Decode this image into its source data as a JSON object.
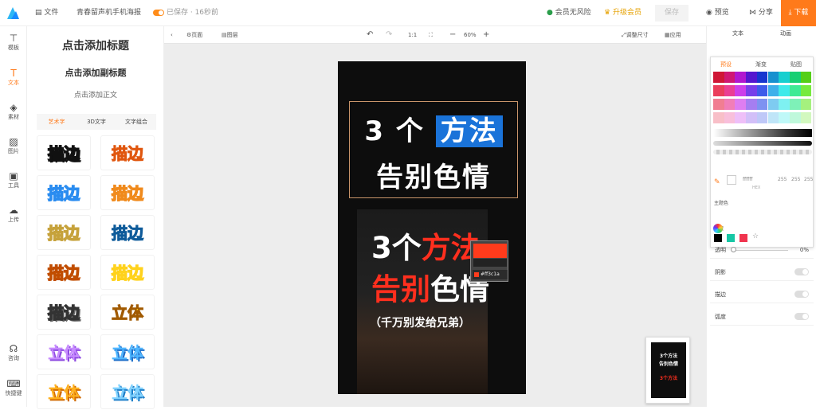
{
  "topbar": {
    "file": "文件",
    "doc_title": "青春留声机手机海报",
    "autosave": "已保存 · 16秒前",
    "no_risk": "会员无风险",
    "upgrade": "升级会员",
    "save": "保存",
    "preview": "预览",
    "share": "分享",
    "download": "下载"
  },
  "rail": [
    "模板",
    "文本",
    "素材",
    "图片",
    "工具",
    "上传",
    "咨询",
    "快捷键"
  ],
  "text_panel": {
    "add_title": "点击添加标题",
    "add_subtitle": "点击添加副标题",
    "add_body": "点击添加正文",
    "tabs": [
      "艺术字",
      "3D文字",
      "文字组合"
    ],
    "styles": [
      "描边",
      "描边",
      "描边",
      "描边",
      "描边",
      "描边",
      "描边",
      "描边",
      "描边",
      "立体",
      "立体",
      "立体",
      "立体",
      "立体"
    ]
  },
  "workspace": {
    "page": "页面",
    "layer": "图层",
    "ratio": "1:1",
    "zoom": "60%",
    "resize": "调整尺寸",
    "apply": "应用"
  },
  "poster": {
    "title_num": "3",
    "title_ge": "个",
    "title_hl": "方法",
    "title_line2": "告别色情",
    "photo_line1_a": "3个",
    "photo_line1_b": "方法",
    "photo_line2_a": "告别",
    "photo_line2_b": "色情",
    "photo_line3": "（千万别发给兄弟）",
    "picker_hex": "#ff3c1a"
  },
  "right_panel": {
    "tabs": [
      "文本",
      "动画"
    ],
    "picker_tabs": [
      "预设",
      "渐变",
      "贴图"
    ],
    "hex_label": "HEX",
    "hex_value": "ffffff",
    "r": "255",
    "g": "255",
    "b": "255",
    "theme_colors": "主题色",
    "favorites": "收藏",
    "opacity": "透明",
    "opacity_value": "0%",
    "shadow": "阴影",
    "stroke": "描边",
    "curve": "弧度"
  },
  "colors": {
    "accent": "#ff7a1a",
    "highlight_blue": "#1a73d9",
    "poster_red": "#ff2f1e"
  }
}
